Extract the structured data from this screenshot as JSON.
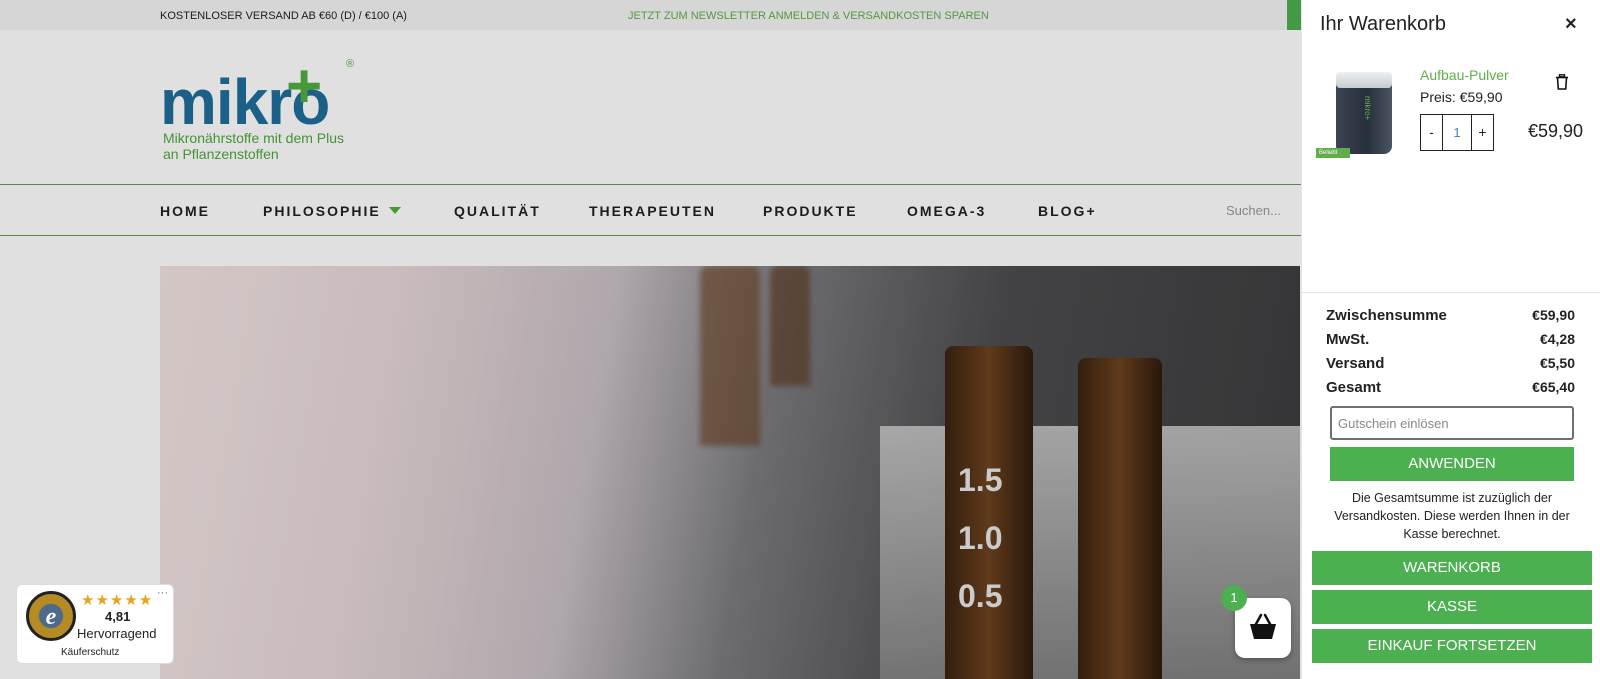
{
  "topbar": {
    "shipping_note": "KOSTENLOSER VERSAND AB €60 (D) / €100 (A)",
    "newsletter": "JETZT ZUM NEWSLETTER ANMELDEN & VERSANDKOSTEN SPAREN"
  },
  "logo": {
    "word": "mikro",
    "plus": "+",
    "registered": "®",
    "tagline": "Mikronährstoffe mit dem Plus an Pflanzenstoffen"
  },
  "nav": {
    "items": [
      "HOME",
      "PHILOSOPHIE",
      "QUALITÄT",
      "THERAPEUTEN",
      "PRODUKTE",
      "OMEGA-3",
      "BLOG+"
    ],
    "search_placeholder": "Suchen..."
  },
  "hero": {
    "labels": [
      "1.5",
      "1.0",
      "0.5"
    ]
  },
  "trusted_shops": {
    "stars": "★★★★★",
    "rating": "4,81",
    "rating_text": "Hervorragend",
    "subtitle": "Käuferschutz",
    "more": "···",
    "seal_letter": "e"
  },
  "cart_fab": {
    "count": "1"
  },
  "cart": {
    "title": "Ihr Warenkorb",
    "close": "×",
    "item": {
      "name": "Aufbau-Pulver",
      "price_label": "Preis: €59,90",
      "minus": "-",
      "quantity": "1",
      "plus": "+",
      "total": "€59,90",
      "badge": "Beliebt",
      "jar_text": "mikro+"
    },
    "summary": {
      "subtotal_label": "Zwischensumme",
      "subtotal": "€59,90",
      "vat_label": "MwSt.",
      "vat": "€4,28",
      "shipping_label": "Versand",
      "shipping": "€5,50",
      "total_label": "Gesamt",
      "total": "€65,40"
    },
    "coupon_placeholder": "Gutschein einlösen",
    "apply_label": "ANWENDEN",
    "note": "Die Gesamtsumme ist zuzüglich der Versandkosten. Diese werden Ihnen in der Kasse berechnet.",
    "buttons": {
      "cart": "WARENKORB",
      "checkout": "KASSE",
      "continue": "EINKAUF FORTSETZEN"
    }
  },
  "colors": {
    "accent": "#4caf50",
    "brand_blue": "#1f6f9a",
    "star": "#e8a41b"
  }
}
